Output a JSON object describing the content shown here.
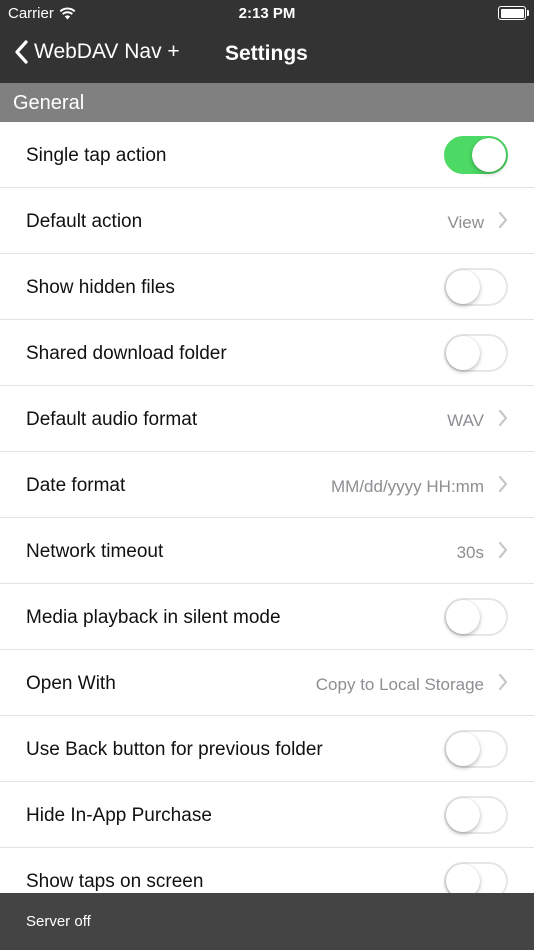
{
  "status_bar": {
    "carrier": "Carrier",
    "time": "2:13 PM",
    "wifi_icon": "wifi-icon",
    "battery_icon": "battery-icon"
  },
  "nav": {
    "back_label": "WebDAV Nav +",
    "title": "Settings",
    "back_icon": "chevron-left-icon"
  },
  "section": {
    "title": "General"
  },
  "rows": [
    {
      "label": "Single tap action",
      "kind": "toggle",
      "on": true
    },
    {
      "label": "Default action",
      "kind": "value",
      "value": "View"
    },
    {
      "label": "Show hidden files",
      "kind": "toggle",
      "on": false
    },
    {
      "label": "Shared download folder",
      "kind": "toggle",
      "on": false
    },
    {
      "label": "Default audio format",
      "kind": "value",
      "value": "WAV"
    },
    {
      "label": "Date format",
      "kind": "value",
      "value": "MM/dd/yyyy HH:mm"
    },
    {
      "label": "Network timeout",
      "kind": "value",
      "value": "30s"
    },
    {
      "label": "Media playback in silent mode",
      "kind": "toggle",
      "on": false
    },
    {
      "label": "Open With",
      "kind": "value",
      "value": "Copy to Local Storage"
    },
    {
      "label": "Use Back button for previous folder",
      "kind": "toggle",
      "on": false
    },
    {
      "label": "Hide In-App Purchase",
      "kind": "toggle",
      "on": false
    },
    {
      "label": "Show taps on screen",
      "kind": "toggle",
      "on": false
    }
  ],
  "footer": {
    "status": "Server off"
  },
  "colors": {
    "bar": "#333333",
    "section": "#808080",
    "toggle_on": "#4cd964",
    "footer": "#444444"
  }
}
